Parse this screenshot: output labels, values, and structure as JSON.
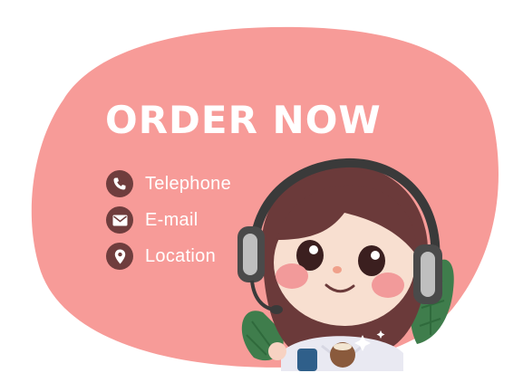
{
  "banner": {
    "title": "ORDER NOW",
    "contacts": [
      {
        "label": "Telephone",
        "icon": "phone-icon"
      },
      {
        "label": "E-mail",
        "icon": "envelope-icon"
      },
      {
        "label": "Location",
        "icon": "location-pin-icon"
      }
    ],
    "colors": {
      "background_blob": "#f79b98",
      "icon_circle": "#6f3d3d",
      "text": "#ffffff",
      "leaf": "#3f7d4c"
    },
    "illustration": "girl-with-headset"
  }
}
